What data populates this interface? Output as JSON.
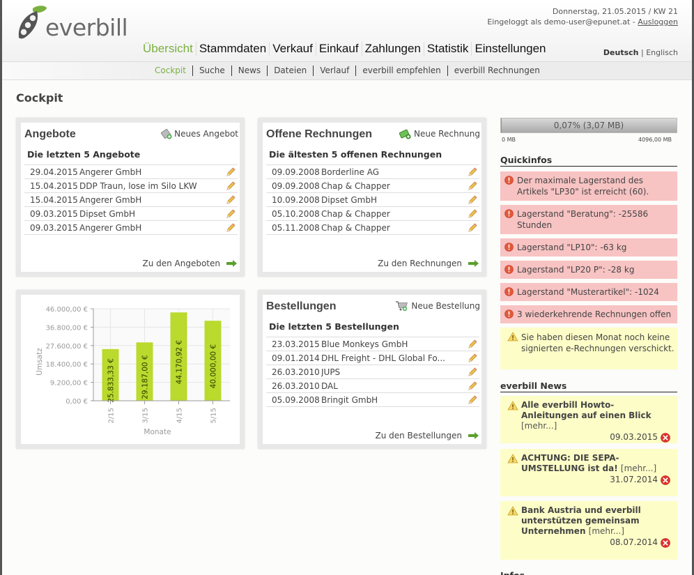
{
  "brand": {
    "name": "everbill"
  },
  "topinfo": {
    "date_line": "Donnerstag, 21.05.2015 / KW 21",
    "logged_in_prefix": "Eingeloggt als demo-user@epunet.at - ",
    "logout": "Ausloggen"
  },
  "language": {
    "active": "Deutsch",
    "separator": " | ",
    "other": "Englisch"
  },
  "mainnav": [
    {
      "label": "Übersicht",
      "active": true
    },
    {
      "label": "Stammdaten"
    },
    {
      "label": "Verkauf"
    },
    {
      "label": "Einkauf"
    },
    {
      "label": "Zahlungen"
    },
    {
      "label": "Statistik"
    },
    {
      "label": "Einstellungen"
    }
  ],
  "subnav": [
    {
      "label": "Cockpit",
      "active": true
    },
    {
      "label": "Suche"
    },
    {
      "label": "News"
    },
    {
      "label": "Dateien"
    },
    {
      "label": "Verlauf"
    },
    {
      "label": "everbill empfehlen"
    },
    {
      "label": "everbill Rechnungen"
    }
  ],
  "page_title": "Cockpit",
  "panels": {
    "angebote": {
      "title": "Angebote",
      "action": "Neues Angebot",
      "subtitle": "Die letzten 5 Angebote",
      "rows": [
        {
          "date": "29.04.2015",
          "name": "Angerer GmbH"
        },
        {
          "date": "15.04.2015",
          "name": "DDP Traun, lose im Silo LKW"
        },
        {
          "date": "15.04.2015",
          "name": "Angerer GmbH"
        },
        {
          "date": "09.03.2015",
          "name": "Dipset GmbH"
        },
        {
          "date": "09.03.2015",
          "name": "Angerer GmbH"
        }
      ],
      "link": "Zu den Angeboten"
    },
    "rechnungen": {
      "title": "Offene Rechnungen",
      "action": "Neue Rechnung",
      "subtitle": "Die ältesten 5 offenen Rechnungen",
      "rows": [
        {
          "date": "09.09.2008",
          "name": "Borderline AG"
        },
        {
          "date": "09.09.2008",
          "name": "Chap & Chapper"
        },
        {
          "date": "10.09.2008",
          "name": "Dipset GmbH"
        },
        {
          "date": "05.10.2008",
          "name": "Chap & Chapper"
        },
        {
          "date": "05.11.2008",
          "name": "Chap & Chapper"
        }
      ],
      "link": "Zu den Rechnungen"
    },
    "bestellungen": {
      "title": "Bestellungen",
      "action": "Neue Bestellung",
      "subtitle": "Die letzten 5 Bestellungen",
      "rows": [
        {
          "date": "23.03.2015",
          "name": "Blue Monkeys GmbH"
        },
        {
          "date": "09.01.2014",
          "name": "DHL Freight - DHL Global Fo..."
        },
        {
          "date": "26.03.2010",
          "name": "JUPS"
        },
        {
          "date": "26.03.2010",
          "name": "DAL"
        },
        {
          "date": "05.09.2008",
          "name": "Bringit GmbH"
        }
      ],
      "link": "Zu den Bestellungen"
    }
  },
  "chart_data": {
    "type": "bar",
    "title": "",
    "xlabel": "Monate",
    "ylabel": "Umsatz",
    "categories": [
      "2/15",
      "3/15",
      "4/15",
      "5/15"
    ],
    "values": [
      25833.33,
      29187.0,
      44170.92,
      40000.0
    ],
    "value_labels": [
      "25.833,33 €",
      "29.187,00 €",
      "44.170,92 €",
      "40.000,00 €"
    ],
    "ylim": [
      0,
      46000
    ],
    "yticks": [
      0,
      9200,
      18400,
      27600,
      36800,
      46000
    ],
    "ytick_labels": [
      "0,00 €",
      "9.200,00 €",
      "18.400,00 €",
      "27.600,00 €",
      "36.800,00 €",
      "46.000,00 €"
    ],
    "grid": true,
    "bar_color": "#bada2d",
    "legend": "none"
  },
  "storage": {
    "label": "0,07% (3,07 MB)",
    "used_fraction": 0.0007,
    "min_label": "0 MB",
    "max_label": "4096,00 MB"
  },
  "quickinfos": {
    "title": "Quickinfos",
    "items": [
      {
        "type": "error",
        "text": "Der maximale Lagerstand des Artikels \"LP30\" ist erreicht (60)."
      },
      {
        "type": "error",
        "text": "Lagerstand \"Beratung\": -25586 Stunden"
      },
      {
        "type": "error",
        "text": "Lagerstand \"LP10\": -63 kg"
      },
      {
        "type": "error",
        "text": "Lagerstand \"LP20 P\": -28 kg"
      },
      {
        "type": "error",
        "text": "Lagerstand \"Musterartikel\": -1024"
      },
      {
        "type": "error",
        "text": "3 wiederkehrende Rechnungen offen"
      },
      {
        "type": "warning",
        "text": "Sie haben diesen Monat noch keine signierten e-Rechnungen verschickt."
      }
    ]
  },
  "news": {
    "title": "everbill News",
    "more_label": "[mehr...]",
    "items": [
      {
        "title": "Alle everbill Howto-Anleitungen auf einen Blick",
        "date": "09.03.2015"
      },
      {
        "title": "ACHTUNG: DIE SEPA-UMSTELLUNG ist da!",
        "date": "31.07.2014"
      },
      {
        "title": "Bank Austria und everbill unterstützen gemeinsam Unternehmen",
        "date": "08.07.2014"
      }
    ]
  },
  "infos_title_partial": "Infos",
  "colors": {
    "accent": "#7ab040",
    "error_bg": "#f8c3c3",
    "warning_bg": "#fdfdc8",
    "bar": "#bada2d"
  }
}
